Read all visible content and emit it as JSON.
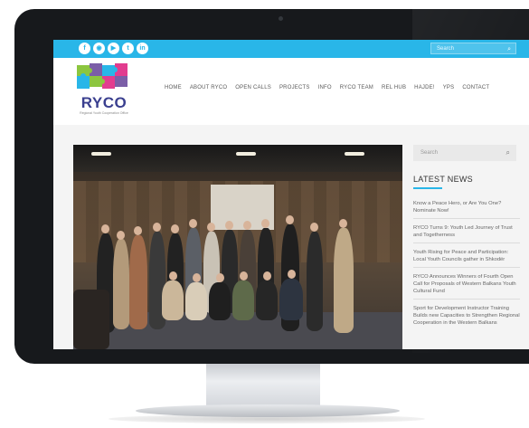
{
  "site": {
    "logo_text": "RYCO",
    "logo_subtitle": "Regional Youth Cooperation Office",
    "social_icons": [
      "facebook-icon",
      "instagram-icon",
      "youtube-icon",
      "twitter-icon",
      "linkedin-icon"
    ],
    "search_placeholder": "Search",
    "nav": [
      "HOME",
      "ABOUT RYCO",
      "OPEN CALLS",
      "PROJECTS",
      "INFO",
      "RYCO TEAM",
      "REL HUB",
      "HAJDE!",
      "YPS",
      "CONTACT"
    ],
    "colors": {
      "topbar": "#29b6e8",
      "logo_text": "#3a3f8f"
    }
  },
  "sidebar": {
    "search_placeholder": "Search",
    "latest_news_title": "LATEST NEWS",
    "news": [
      "Know a Peace Hero, or Are You One? Nominate Now!",
      "RYCO Turns 9: Youth Led Journey of Trust and Togetherness",
      "Youth Rising for Peace and Participation: Local Youth Councils gather in Shkodër",
      "RYCO Announces Winners of Fourth Open Call for Proposals of Western Balkans Youth Cultural Fund",
      "Sport for Development Instructor Training Builds new Capacities to Strengthen Regional Cooperation in the Western Balkans"
    ]
  }
}
